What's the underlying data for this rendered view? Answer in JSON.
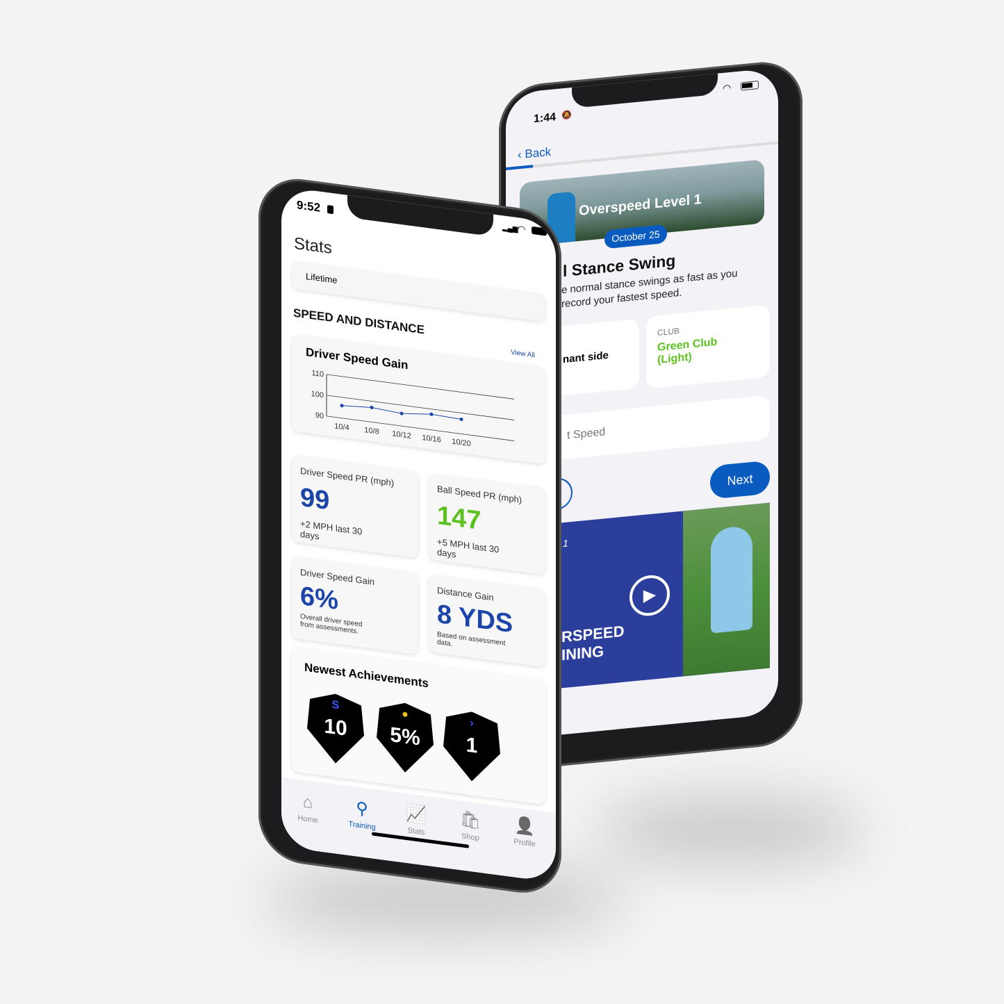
{
  "back_phone": {
    "status": {
      "time": "1:44",
      "mute_icon": "bell-slash-icon",
      "wifi_icon": "wifi-icon",
      "battery_icon": "battery-icon"
    },
    "nav": {
      "back_label": "Back",
      "progress_percent": 10
    },
    "banner": {
      "title": "Overspeed Level 1",
      "date_badge": "October 25"
    },
    "exercise": {
      "title": "l Stance Swing",
      "description_line1": "e normal stance swings as fast as you",
      "description_line2": "record your fastest speed."
    },
    "side_card": {
      "value": "nant side"
    },
    "club_card": {
      "label": "CLUB",
      "value_line1": "Green Club",
      "value_line2": "(Light)",
      "value_color": "#5cc21f"
    },
    "speed_input": {
      "placeholder": "t Speed"
    },
    "next_button": "Next",
    "video": {
      "line_partial": "1",
      "title_line1": "RSPEED",
      "title_line2": "INING",
      "play_icon": "play-circle-icon"
    },
    "accent": "#0a5bbf"
  },
  "front_phone": {
    "status": {
      "time": "9:52",
      "sim_icon": "sim-icon",
      "signal_icon": "signal-icon",
      "wifi_icon": "wifi-icon",
      "battery_icon": "battery-icon"
    },
    "page_title": "Stats",
    "period_select": "Lifetime",
    "section_title": "SPEED AND DISTANCE",
    "view_all": "View All",
    "chart_card_title": "Driver Speed Gain",
    "stats": [
      {
        "label": "Driver Speed PR (mph)",
        "value": "99",
        "note": "+2 MPH last 30 days",
        "color": "#1b45a8"
      },
      {
        "label": "Ball Speed PR (mph)",
        "value": "147",
        "note": "+5 MPH last 30 days",
        "color": "#5cc21f"
      },
      {
        "label": "Driver Speed Gain",
        "value": "6%",
        "note": "Overall driver speed from assessments.",
        "color": "#1b45a8"
      },
      {
        "label": "Distance Gain",
        "value": "8 YDS",
        "note": "Based on assessment data.",
        "color": "#1b45a8"
      }
    ],
    "achievements": {
      "title": "Newest Achievements",
      "badges": [
        {
          "value": "10",
          "icon": "swoosh-icon",
          "icon_color": "#3b5bff"
        },
        {
          "value": "5%",
          "icon": "bomb-icon",
          "icon_color": "#e8c21b"
        },
        {
          "value": "1",
          "icon": "chevron-right-icon",
          "icon_color": "#3b5bff"
        }
      ]
    },
    "tabs": [
      {
        "label": "Home",
        "icon": "home-icon",
        "active": false
      },
      {
        "label": "Training",
        "icon": "golf-ball-tee-icon",
        "active": true
      },
      {
        "label": "Stats",
        "icon": "chart-trend-icon",
        "active": false
      },
      {
        "label": "Shop",
        "icon": "shopping-bag-icon",
        "active": false
      },
      {
        "label": "Profile",
        "icon": "profile-icon",
        "active": false
      }
    ]
  },
  "chart_data": {
    "type": "line",
    "title": "Driver Speed Gain",
    "categories": [
      "10/4",
      "10/8",
      "10/12",
      "10/16",
      "10/20"
    ],
    "values": [
      96,
      97,
      96,
      97.5,
      97
    ],
    "yticks": [
      90,
      100,
      110
    ],
    "ylim": [
      90,
      110
    ],
    "grid": true,
    "color": "#1b45a8"
  }
}
